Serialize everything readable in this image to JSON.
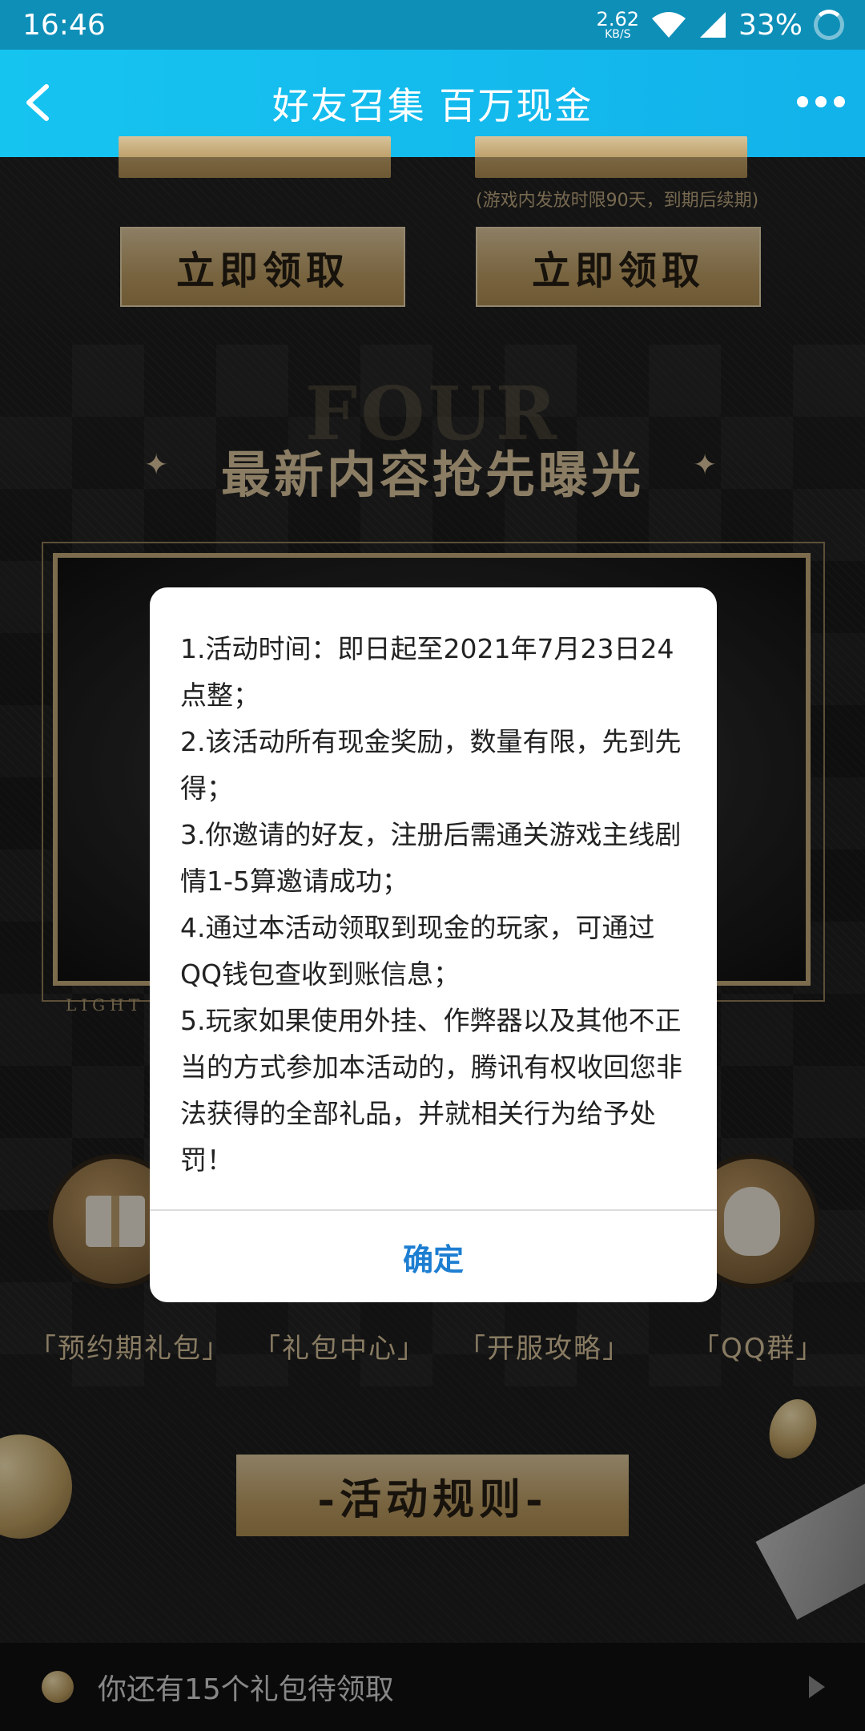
{
  "status_bar": {
    "time": "16:46",
    "net_speed_value": "2.62",
    "net_speed_unit": "KB/S",
    "battery": "33%"
  },
  "app_bar": {
    "title": "好友召集 百万现金"
  },
  "background": {
    "note": "(游戏内发放时限90天，到期后续期)",
    "claim_left": "立即领取",
    "claim_right": "立即领取",
    "section_eng": "FOUR",
    "section_title": "最新内容抢先曝光",
    "light_text": "LIGHT",
    "categories": [
      "「预约期礼包」",
      "「礼包中心」",
      "「开服攻略」",
      "「QQ群」"
    ],
    "rules_button": "-活动规则-",
    "bottom_text": "你还有15个礼包待领取"
  },
  "dialog": {
    "rules": [
      "1.活动时间：即日起至2021年7月23日24点整；",
      "2.该活动所有现金奖励，数量有限，先到先得；",
      "3.你邀请的好友，注册后需通关游戏主线剧情1-5算邀请成功；",
      "4.通过本活动领取到现金的玩家，可通过QQ钱包查收到账信息；",
      "5.玩家如果使用外挂、作弊器以及其他不正当的方式参加本活动的，腾讯有权收回您非法获得的全部礼品，并就相关行为给予处罚！"
    ],
    "confirm": "确定"
  },
  "colors": {
    "app_bar": "#16c4f0",
    "gold": "#c7ab79",
    "confirm": "#1d7ed1"
  }
}
